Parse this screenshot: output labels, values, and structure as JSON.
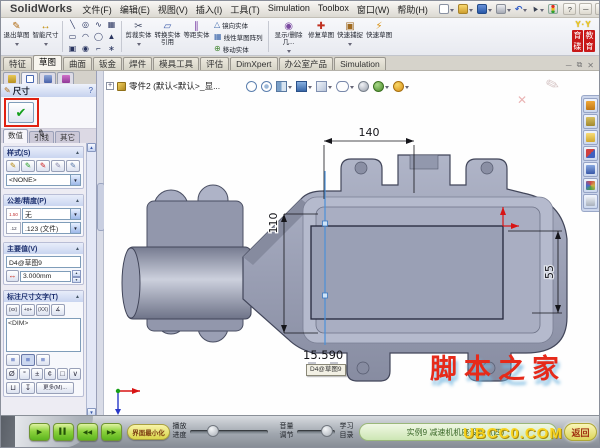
{
  "titlebar": {
    "app": "SolidWorks",
    "menus": [
      "文件(F)",
      "编辑(E)",
      "视图(V)",
      "插入(I)",
      "工具(T)",
      "Simulation",
      "Toolbox",
      "窗口(W)",
      "帮助(H)"
    ]
  },
  "glyphs": {
    "caret": "▾",
    "help": "?",
    "minimize": "─",
    "restore": "⧉",
    "close": "✕",
    "undo": "↶",
    "select": "▲",
    "tree_plus": "+",
    "pencil": "✎",
    "dim_icon": "↔",
    "scissors": "✂",
    "convert": "▱",
    "offset": "∥",
    "mirror": "△",
    "pattern": "▦",
    "move": "⊕",
    "display_del": "◉",
    "repair": "✚",
    "snap": "▣",
    "rapid": "⚡",
    "grid": [
      "╲",
      "◎",
      "∿",
      "▦",
      "▭",
      "◠",
      "◯",
      "▲",
      "▣",
      "◉",
      "⌐",
      "∗"
    ],
    "check": "✔",
    "chevron_up": "▲",
    "scroll_up": "▲",
    "scroll_down": "▼",
    "spin_up": "▲",
    "spin_down": "▼",
    "txt_btns": [
      "(xx)",
      "+x+",
      "(XX)",
      "∡"
    ],
    "justify": "≡",
    "symbols": [
      "Ø",
      "°",
      "±",
      "¢",
      "□",
      "∨"
    ],
    "cup": "⊔",
    "anchor": "↧",
    "flip": "↔",
    "play": "▶",
    "pause": "▌▌",
    "rewind": "◀◀",
    "forward": "▶▶"
  },
  "brand": {
    "yy": "Y·Y",
    "col1": "育碟",
    "col2": "教育"
  },
  "toolbar": {
    "items": [
      {
        "label": "退出草图"
      },
      {
        "label": "智能尺寸"
      },
      {
        "label": "剪裁实体"
      },
      {
        "label": "转换实体引用"
      },
      {
        "label": "等距实体"
      },
      {
        "label": "镜向实体"
      },
      {
        "label": "线性草图阵列"
      },
      {
        "label": "移动实体"
      },
      {
        "label": "显示/删除几..."
      },
      {
        "label": "修复草图"
      },
      {
        "label": "快速捕捉"
      },
      {
        "label": "快速草图"
      }
    ]
  },
  "cmdtabs": {
    "items": [
      {
        "label": "特征"
      },
      {
        "label": "草图"
      },
      {
        "label": "曲面"
      },
      {
        "label": "钣金"
      },
      {
        "label": "焊件"
      },
      {
        "label": "模具工具"
      },
      {
        "label": "评估"
      },
      {
        "label": "DimXpert"
      },
      {
        "label": "办公室产品"
      },
      {
        "label": "Simulation"
      }
    ]
  },
  "pm": {
    "header": "尺寸",
    "tabs": [
      "数值",
      "引线",
      "其它"
    ],
    "style": {
      "title": "样式(S)",
      "none": "<NONE>"
    },
    "tolerance": {
      "title": "公差/精度(P)",
      "icon1": "1.50",
      "icon2": ".12",
      "v1": "无",
      "v2": ".123 (文件)"
    },
    "primary": {
      "title": "主要值(V)",
      "name": "D4@草图9",
      "value": "3.000mm"
    },
    "dimtext": {
      "title": "标注尺寸文字(T)",
      "body": "<DIM>",
      "more": "更多(M)..."
    }
  },
  "gfx": {
    "doc_label": "零件2 (默认<默认>_显...",
    "dims": {
      "width": "140",
      "height": "110",
      "right": "55",
      "active": "15.590"
    },
    "tag": "D4@草图9",
    "watermark": "脚本之家"
  },
  "player": {
    "minimize": "界面最小化",
    "progress": "播放进度",
    "volume": "音量调节",
    "catalog": "学习目录",
    "lesson": "实例9 减速机机座设计（四）",
    "back": "返回",
    "site": "UBCC0.COM"
  }
}
